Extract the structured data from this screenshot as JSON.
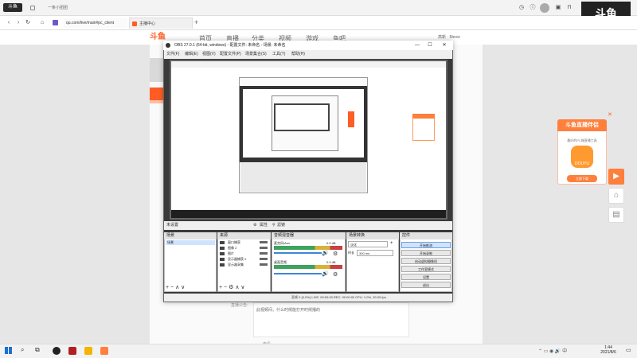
{
  "browser": {
    "brand_mini": "斗鱼",
    "tab_recent": "一条小团团",
    "url": "qu.com/live/main#pc_client",
    "tab_label": "主播中心",
    "brand_right": "斗鱼"
  },
  "site": {
    "logo": "斗鱼",
    "nav": [
      "首页",
      "直播",
      "分类",
      "视频",
      "游戏",
      "鱼吧"
    ],
    "user": "高新 · Meow"
  },
  "page": {
    "note_label": "直播公告:",
    "note_text": "此视频间，什么时候能打开时候播的",
    "more": "查看"
  },
  "ad": {
    "title": "斗鱼直播伴侣",
    "subtitle": "最好的PC端直播工具",
    "badge": "DOUYU",
    "button": "立即下载"
  },
  "obs": {
    "title": "OBS 27.0.1 (64-bit, windows) - 配置文件: 未命名 - 场景: 未命名",
    "menu": [
      "文件(F)",
      "编辑(E)",
      "视图(V)",
      "配置文件(P)",
      "场景集合(S)",
      "工具(T)",
      "帮助(H)"
    ],
    "status_left": "未设置",
    "status_props": "属性",
    "status_filter": "滤镜",
    "docks": {
      "scenes": "场景",
      "sources": "来源",
      "mixer": "音频混音器",
      "transitions": "场景转换",
      "controls": "控件"
    },
    "scene_items": [
      "场景"
    ],
    "source_items": [
      "窗口捕获",
      "图像 2",
      "图片",
      "显示器捕获 2",
      "显示器采集"
    ],
    "mixer_tracks": [
      {
        "name": "桌面音频",
        "db": "0.0 dB"
      },
      {
        "name": "麦克风/Aux",
        "db": "0.0 dB"
      }
    ],
    "transition_type": "淡化",
    "transition_duration_label": "时长",
    "transition_duration": "300 ms",
    "controls_buttons": [
      "开始推流",
      "开始录制",
      "启动虚拟摄像机",
      "工作室模式",
      "设置",
      "退出"
    ],
    "bottom_status": "丢帧 0 (0.0%)    LIVE: 00:00:00    REC: 00:00:00    CPU: 1.0%, 30.00 fps"
  },
  "taskbar": {
    "time": "1:44",
    "date": "2021/8/6"
  },
  "colors": {
    "accent": "#ff5d23",
    "obs_dark": "#3a3a3a"
  }
}
